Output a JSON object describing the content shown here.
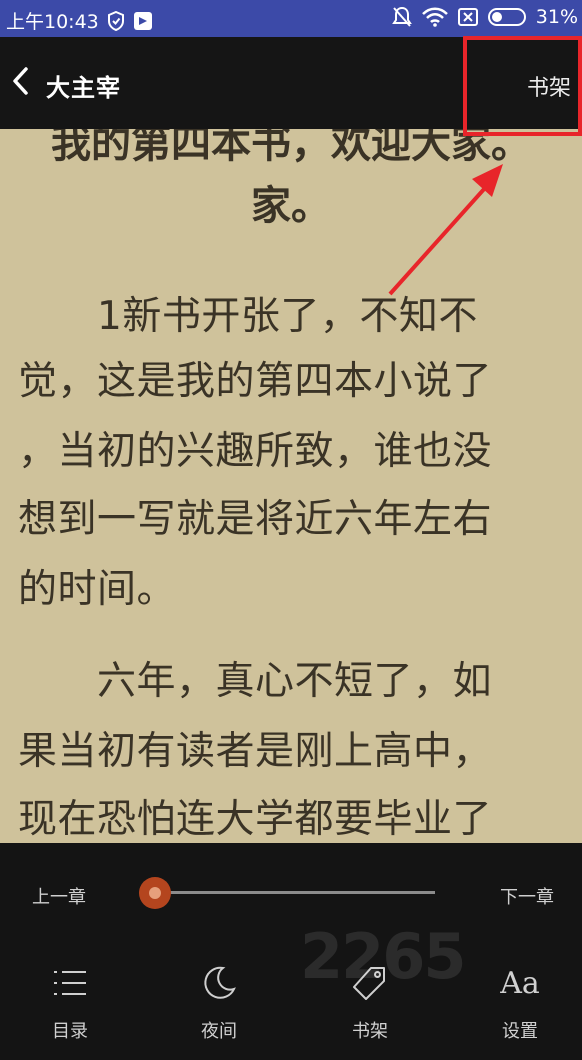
{
  "status_bar": {
    "time": "上午10:43",
    "battery_percent": "31%"
  },
  "top_bar": {
    "book_title": "大主宰",
    "bookshelf_label": "书架"
  },
  "content": {
    "heading_line1": "我的第四本书，欢迎大家。",
    "heading_line2": "家。",
    "lines": [
      "　　1新书开张了，不知不",
      "觉，这是我的第四本小说了",
      "，当初的兴趣所致，谁也没",
      "想到一写就是将近六年左右",
      "的时间。",
      "　　六年，真心不短了，如",
      "果当初有读者是刚上高中，",
      "现在恐怕连大学都要毕业了"
    ]
  },
  "reader_controls": {
    "prev_chapter": "上一章",
    "next_chapter": "下一章",
    "progress_fraction": 0
  },
  "bottom_nav": [
    {
      "label": "目录",
      "icon": "list-icon"
    },
    {
      "label": "夜间",
      "icon": "moon-icon"
    },
    {
      "label": "书架",
      "icon": "tag-icon"
    },
    {
      "label": "设置",
      "icon": "font-size-icon"
    }
  ],
  "watermark": "2265",
  "annotation": {
    "color": "#e8252a"
  }
}
